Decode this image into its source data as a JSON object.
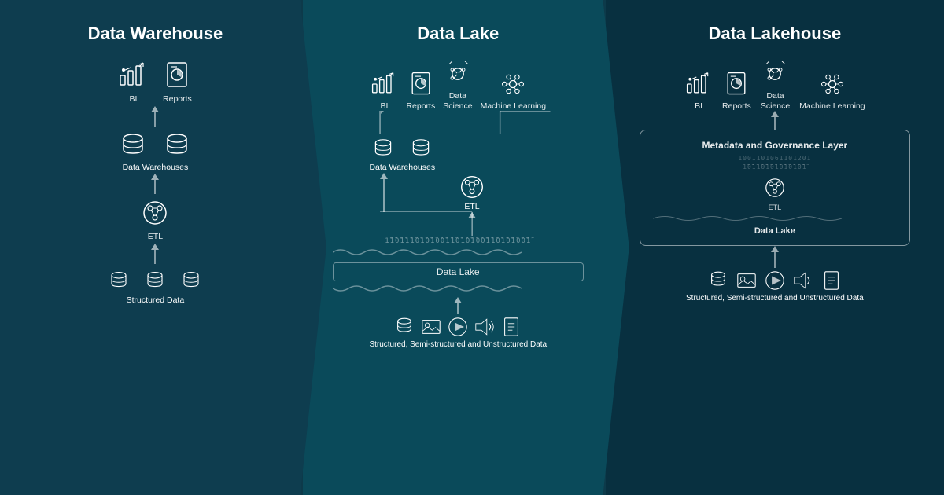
{
  "sections": [
    {
      "id": "data-warehouse",
      "title": "Data Warehouse",
      "outputs": [
        "BI",
        "Reports"
      ],
      "layer1": "Data Warehouses",
      "layer2": "ETL",
      "layer3": "Structured Data"
    },
    {
      "id": "data-lake",
      "title": "Data Lake",
      "outputs": [
        "BI",
        "Reports",
        "Data Science",
        "Machine Learning"
      ],
      "layer1": "Data Warehouses",
      "layer2": "ETL",
      "layer3_label": "Data Lake",
      "layer4": "Structured, Semi-structured and Unstructured Data"
    },
    {
      "id": "data-lakehouse",
      "title": "Data Lakehouse",
      "outputs": [
        "BI",
        "Reports",
        "Data Science",
        "Machine Learning"
      ],
      "governance_label": "Metadata and Governance Layer",
      "lake_label": "Data Lake",
      "layer4": "Structured, Semi-structured and Unstructured Data"
    }
  ],
  "binary_text": "1101110101001101010011010100",
  "binary_text2": "01101001011010010110100101"
}
